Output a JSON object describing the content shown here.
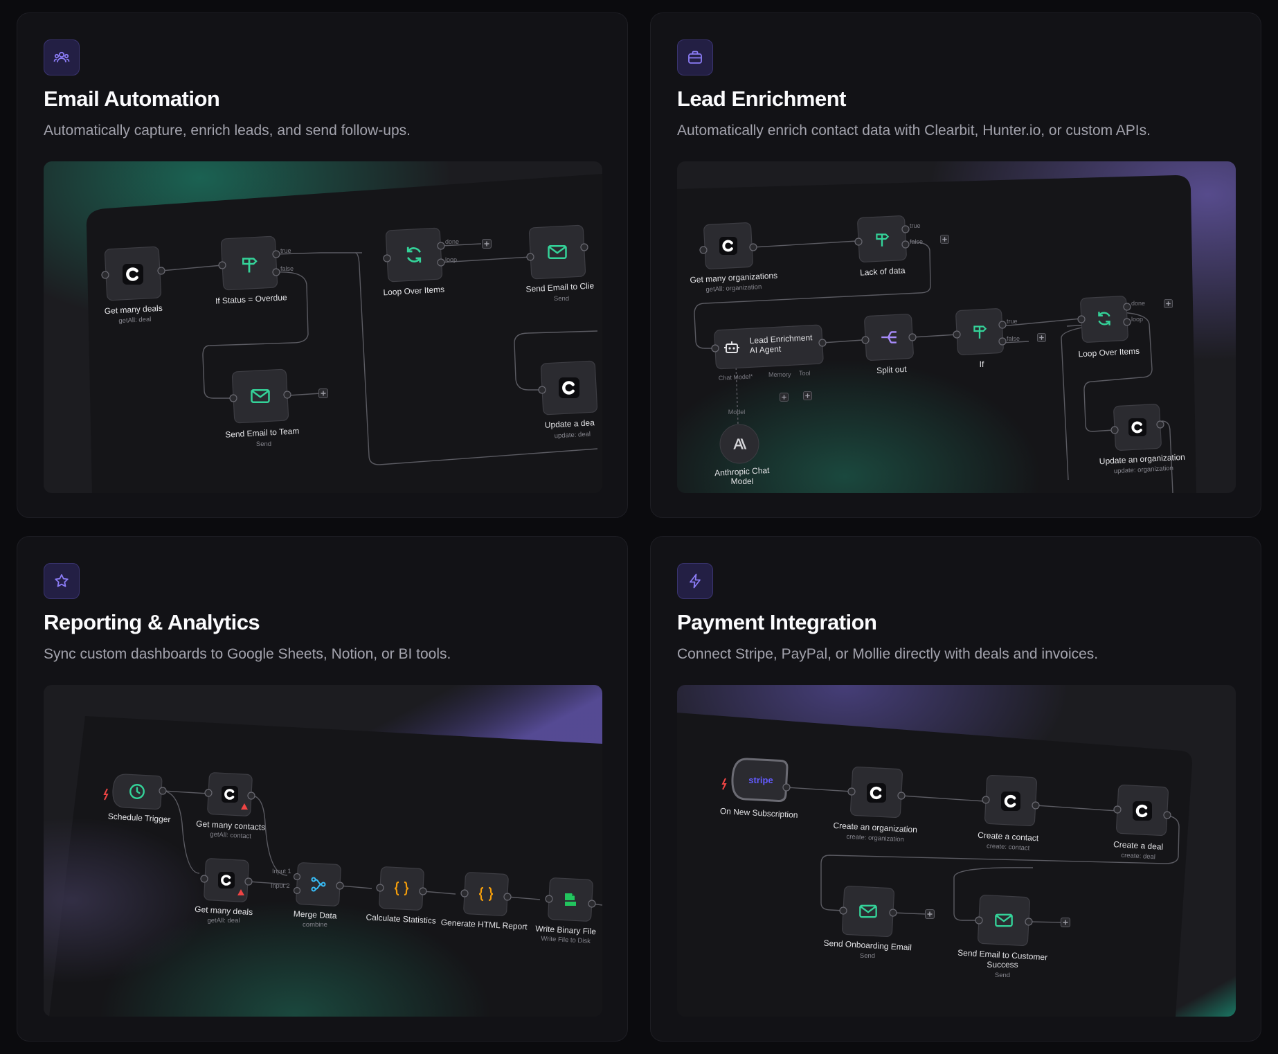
{
  "cards": [
    {
      "icon": "users-icon",
      "title": "Email Automation",
      "description": "Automatically capture, enrich leads, and send follow-ups.",
      "workflow": {
        "n1_label": "Get many deals",
        "n1_sub": "getAll: deal",
        "n2_label": "If Status = Overdue",
        "n2_true": "true",
        "n2_false": "false",
        "n3_label": "Loop Over Items",
        "n3_done": "done",
        "n3_loop": "loop",
        "n4_label": "Send Email to Clie",
        "n4_sub": "Send",
        "n5_label": "Send Email to Team",
        "n5_sub": "Send",
        "n6_label": "Update a dea",
        "n6_sub": "update: deal"
      }
    },
    {
      "icon": "briefcase-icon",
      "title": "Lead Enrichment",
      "description": "Automatically enrich contact data with Clearbit, Hunter.io, or custom APIs.",
      "workflow": {
        "n1_label": "Get many organizations",
        "n1_sub": "getAll: organization",
        "n2_label": "Lack of data",
        "n2_true": "true",
        "n2_false": "false",
        "agent_l1": "Lead Enrichment",
        "agent_l2": "AI Agent",
        "agent_chat": "Chat Model*",
        "agent_memory": "Memory",
        "agent_tool": "Tool",
        "model_port": "Model",
        "anth_l1": "Anthropic Chat",
        "anth_l2": "Model",
        "split_label": "Split out",
        "if_label": "If",
        "if_true": "true",
        "if_false": "false",
        "loop_label": "Loop Over Items",
        "loop_done": "done",
        "loop_loop": "loop",
        "upd_label": "Update an organization",
        "upd_sub": "update: organization"
      }
    },
    {
      "icon": "star-icon",
      "title": "Reporting & Analytics",
      "description": "Sync custom dashboards to Google Sheets, Notion, or BI tools.",
      "workflow": {
        "sched_label": "Schedule Trigger",
        "gc_label": "Get many contacts",
        "gc_sub": "getAll: contact",
        "gd_label": "Get many deals",
        "gd_sub": "getAll: deal",
        "merge_label": "Merge Data",
        "merge_sub": "combine",
        "merge_in1": "Input 1",
        "merge_in2": "Input 2",
        "calc_label": "Calculate Statistics",
        "html_label": "Generate HTML Report",
        "bin_label": "Write Binary File",
        "bin_sub": "Write File to Disk"
      }
    },
    {
      "icon": "lightning-icon",
      "title": "Payment Integration",
      "description": "Connect Stripe, PayPal, or Mollie directly with deals and invoices.",
      "workflow": {
        "stripe_logo": "stripe",
        "stripe_label": "On New Subscription",
        "org_label": "Create an organization",
        "org_sub": "create: organization",
        "contact_label": "Create a contact",
        "contact_sub": "create: contact",
        "deal_label": "Create a deal",
        "deal_sub": "create: deal",
        "onb_label": "Send Onboarding Email",
        "onb_sub": "Send",
        "cs_l1": "Send Email to Customer",
        "cs_l2": "Success",
        "cs_sub": "Send"
      }
    }
  ],
  "colors": {
    "accent": "#8b7cf6",
    "icon_bg": "#231f44",
    "green": "#34d399",
    "orange": "#f59e0b",
    "purple": "#a78bfa",
    "teal": "#38bdf8",
    "stripe": "#635bff"
  }
}
